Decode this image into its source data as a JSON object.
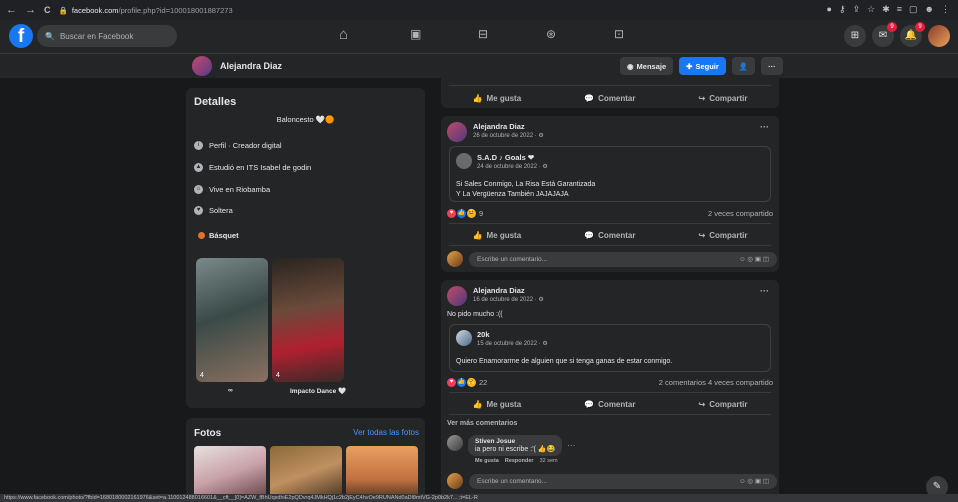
{
  "browser": {
    "nav_back": "←",
    "nav_fwd": "→",
    "reload": "C",
    "url_domain": "facebook.com",
    "url_path": "/profile.php?id=100018001887273"
  },
  "header": {
    "search_placeholder": "Buscar en Facebook",
    "notif_badge": "9",
    "msg_badge": "9"
  },
  "profile": {
    "name": "Alejandra Diaz",
    "btn_message": "Mensaje",
    "btn_follow": "Seguir"
  },
  "details": {
    "title": "Detalles",
    "bio": "Baloncesto 🤍🟠",
    "rows": [
      "Perfil · Creador digital",
      "Estudió en ITS Isabel de godin",
      "Vive en Riobamba",
      "Soltera"
    ],
    "hobby": "Básquet",
    "story_1_count": "4",
    "story_2_count": "4",
    "story_1_label": "∞",
    "story_2_label": "Impacto Dance 🤍"
  },
  "photos": {
    "title": "Fotos",
    "link": "Ver todas las fotos"
  },
  "actions": {
    "like": "Me gusta",
    "comment": "Comentar",
    "share": "Compartir"
  },
  "post1": {
    "author": "Alejandra Diaz",
    "date": "26 de octubre de 2022 · ⚙",
    "shared_author": "S.A.D ♪ Goals ❤",
    "shared_date": "24 de octubre de 2022 · ⚙",
    "text1": "Si Sales Conmigo, La Risa Está Garantizada",
    "text2": "Y La Vergüenza También JAJAJAJA",
    "reactions": "9",
    "shares": "2 veces compartido",
    "comment_placeholder": "Escribe un comentario..."
  },
  "post2": {
    "author": "Alejandra Diaz",
    "date": "16 de octubre de 2022 · ⚙",
    "text": "No pido mucho :((",
    "shared_author": "20k",
    "shared_date": "15 de octubre de 2022 · ⚙",
    "shared_text": "Quiero Enamorarme de alguien que si tenga ganas de estar conmigo.",
    "reactions": "22",
    "stats": "2 comentarios  4 veces compartido",
    "more_comments": "Ver más comentarios",
    "commenter": "Stiven Josue",
    "comment": "ia pero ni escribe :'( 👍😂",
    "c_like": "Me gusta",
    "c_reply": "Responder",
    "c_time": "32 sem",
    "comment_placeholder": "Escribe un comentario..."
  },
  "statusbar": "https://www.facebook.com/photo/?fbid=1680180002161976&set=a.110012488016601&__cft__[0]=AZW_fBhUqsdhiE2pQDvrq4JMkHQj1c2b2jEyC4hvOe9RUNANd0aDl8mtVG-2p0b2k7...  ;t=EL-R"
}
